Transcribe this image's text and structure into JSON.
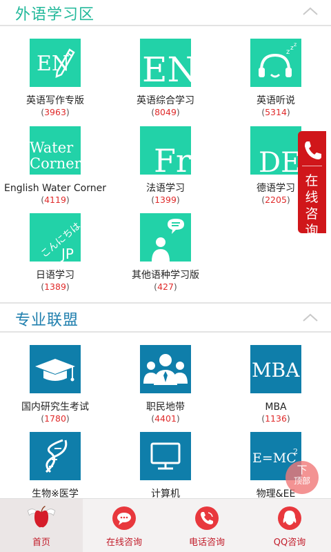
{
  "section_language": {
    "title": "外语学习区"
  },
  "section_professional": {
    "title": "专业联盟"
  },
  "language_items": [
    {
      "name": "英语写作专版",
      "count": "3963",
      "icon": "en-pencil-icon"
    },
    {
      "name": "英语综合学习",
      "count": "8049",
      "icon": "en-letters-icon"
    },
    {
      "name": "英语听说",
      "count": "5314",
      "icon": "headset-speaker-icon"
    },
    {
      "name": "English Water Corner",
      "count": "4119",
      "icon": "water-corner-icon",
      "tile_text_1": "Water",
      "tile_text_2": "Corner"
    },
    {
      "name": "法语学习",
      "count": "1399",
      "icon": "fr-letters-icon",
      "tile_text": "Fr"
    },
    {
      "name": "德语学习",
      "count": "2205",
      "icon": "de-letters-icon",
      "tile_text": "DE"
    },
    {
      "name": "日语学习",
      "count": "1389",
      "icon": "jp-kana-icon",
      "tile_text_1": "こんにちは",
      "tile_text_2": "JP"
    },
    {
      "name": "其他语种学习版",
      "count": "427",
      "icon": "person-speech-icon"
    }
  ],
  "pro_items": [
    {
      "name": "国内研究生考试",
      "count": "1780",
      "icon": "graduation-cap-icon"
    },
    {
      "name": "职民地带",
      "count": "4401",
      "icon": "business-people-icon"
    },
    {
      "name": "MBA",
      "count": "1136",
      "icon": "mba-text-icon",
      "tile_text": "MBA"
    },
    {
      "name": "生物※医学",
      "icon": "dna-icon"
    },
    {
      "name": "计算机",
      "icon": "monitor-icon"
    },
    {
      "name": "物理&EE",
      "icon": "emc2-formula-icon",
      "tile_text": "E=MC",
      "tile_sup": "2"
    }
  ],
  "tile_en": "EN",
  "float_contact": {
    "label": "在线咨询",
    "icon": "phone-icon"
  },
  "back_to_top": {
    "arrow": "下",
    "label": "顶部"
  },
  "tabbar": [
    {
      "label": "首页",
      "icon": "apple-wings-icon"
    },
    {
      "label": "在线咨询",
      "icon": "chat-bubble-icon"
    },
    {
      "label": "电话咨询",
      "icon": "phone-call-icon"
    },
    {
      "label": "QQ咨询",
      "icon": "qq-penguin-icon"
    }
  ],
  "colors": {
    "teal": "#22d2a8",
    "blue": "#0f7eaa",
    "red": "#d0161a",
    "count_red": "#e02a2a"
  }
}
